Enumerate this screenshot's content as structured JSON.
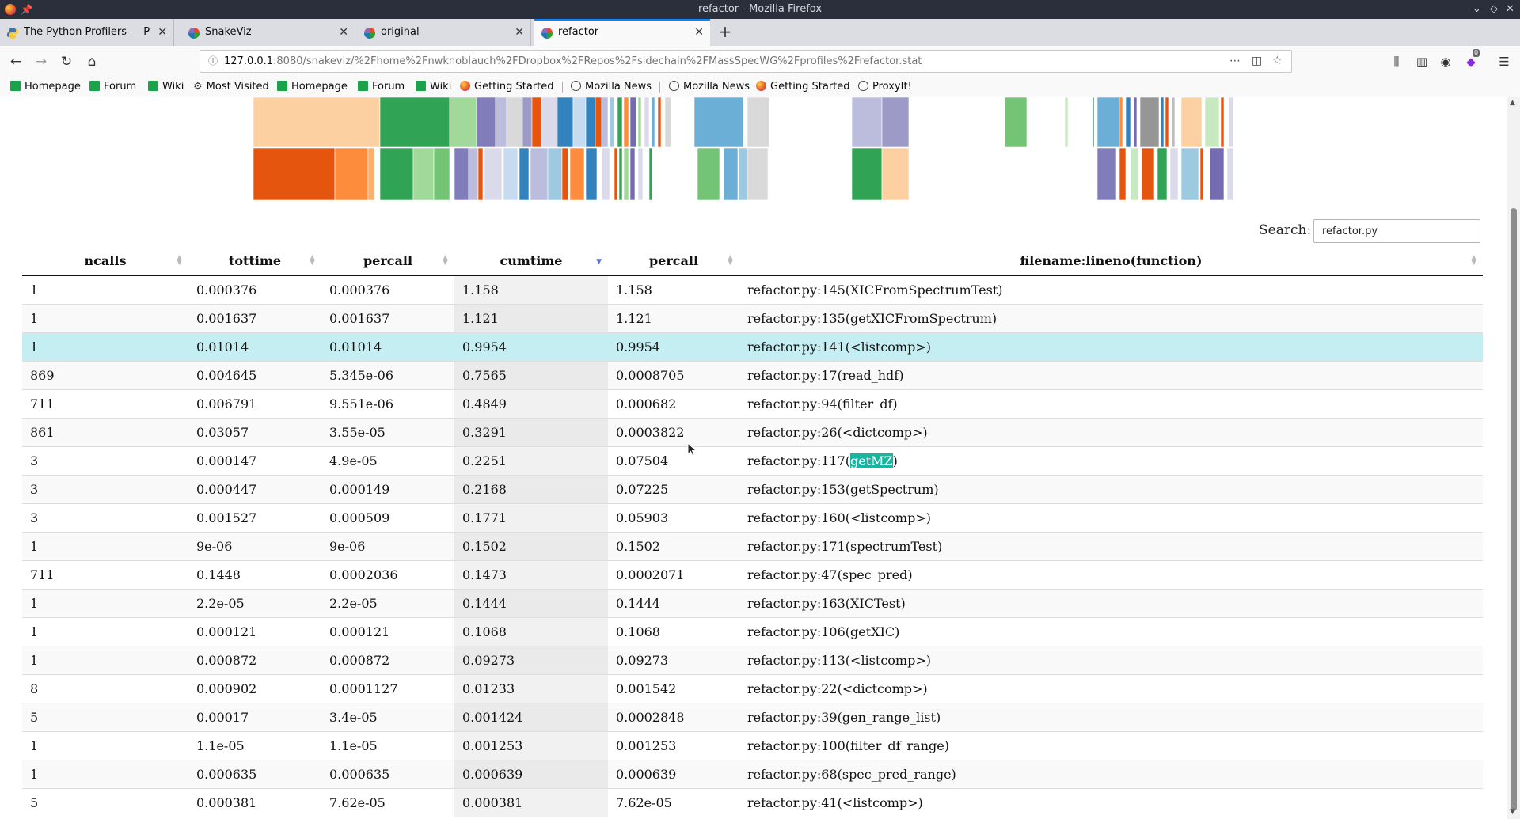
{
  "window": {
    "title": "refactor - Mozilla Firefox"
  },
  "tabs": [
    {
      "label": "The Python Profilers — Pyt",
      "icon": "python-icon"
    },
    {
      "label": "SnakeViz",
      "icon": "snakeviz-icon"
    },
    {
      "label": "original",
      "icon": "snakeviz-icon"
    },
    {
      "label": "refactor",
      "icon": "snakeviz-icon",
      "active": true
    }
  ],
  "urlbar": {
    "host": "127.0.0.1",
    "path": ":8080/snakeviz/%2Fhome%2Fnwknoblauch%2FDropbox%2FRepos%2Fsidechain%2FMassSpecWG%2Fprofiles%2Frefactor.stat"
  },
  "toolbar": {
    "badge": "0"
  },
  "bookmarks": [
    {
      "label": "Homepage",
      "icon": "green"
    },
    {
      "label": "Forum",
      "icon": "green"
    },
    {
      "label": "Wiki",
      "icon": "green"
    },
    {
      "label": "Most Visited",
      "icon": "gear"
    },
    {
      "label": "Homepage",
      "icon": "green"
    },
    {
      "label": "Forum",
      "icon": "green"
    },
    {
      "label": "Wiki",
      "icon": "green"
    },
    {
      "label": "Getting Started",
      "icon": "firefox"
    },
    {
      "label": "Mozilla News",
      "icon": "globe"
    },
    {
      "label": "Mozilla News",
      "icon": "globe"
    },
    {
      "label": "Getting Started",
      "icon": "firefox"
    },
    {
      "label": "ProxyIt!",
      "icon": "globe"
    }
  ],
  "search": {
    "label": "Search:",
    "value": "refactor.py"
  },
  "table": {
    "headers": [
      "ncalls",
      "tottime",
      "percall",
      "cumtime",
      "percall",
      "filename:lineno(function)"
    ],
    "sorted_column": "cumtime",
    "rows": [
      [
        "1",
        "0.000376",
        "0.000376",
        "1.158",
        "1.158",
        "refactor.py:145(XICFromSpectrumTest)"
      ],
      [
        "1",
        "0.001637",
        "0.001637",
        "1.121",
        "1.121",
        "refactor.py:135(getXICFromSpectrum)"
      ],
      [
        "1",
        "0.01014",
        "0.01014",
        "0.9954",
        "0.9954",
        "refactor.py:141(<listcomp>)"
      ],
      [
        "869",
        "0.004645",
        "5.345e-06",
        "0.7565",
        "0.0008705",
        "refactor.py:17(read_hdf)"
      ],
      [
        "711",
        "0.006791",
        "9.551e-06",
        "0.4849",
        "0.000682",
        "refactor.py:94(filter_df)"
      ],
      [
        "861",
        "0.03057",
        "3.55e-05",
        "0.3291",
        "0.0003822",
        "refactor.py:26(<dictcomp>)"
      ],
      [
        "3",
        "0.000147",
        "4.9e-05",
        "0.2251",
        "0.07504",
        "refactor.py:117(getMZ)"
      ],
      [
        "3",
        "0.000447",
        "0.000149",
        "0.2168",
        "0.07225",
        "refactor.py:153(getSpectrum)"
      ],
      [
        "3",
        "0.001527",
        "0.000509",
        "0.1771",
        "0.05903",
        "refactor.py:160(<listcomp>)"
      ],
      [
        "1",
        "9e-06",
        "9e-06",
        "0.1502",
        "0.1502",
        "refactor.py:171(spectrumTest)"
      ],
      [
        "711",
        "0.1448",
        "0.0002036",
        "0.1473",
        "0.0002071",
        "refactor.py:47(spec_pred)"
      ],
      [
        "1",
        "2.2e-05",
        "2.2e-05",
        "0.1444",
        "0.1444",
        "refactor.py:163(XICTest)"
      ],
      [
        "1",
        "0.000121",
        "0.000121",
        "0.1068",
        "0.1068",
        "refactor.py:106(getXIC)"
      ],
      [
        "1",
        "0.000872",
        "0.000872",
        "0.09273",
        "0.09273",
        "refactor.py:113(<listcomp>)"
      ],
      [
        "8",
        "0.000902",
        "0.0001127",
        "0.01233",
        "0.001542",
        "refactor.py:22(<dictcomp>)"
      ],
      [
        "5",
        "0.00017",
        "3.4e-05",
        "0.001424",
        "0.0002848",
        "refactor.py:39(gen_range_list)"
      ],
      [
        "1",
        "1.1e-05",
        "1.1e-05",
        "0.001253",
        "0.001253",
        "refactor.py:100(filter_df_range)"
      ],
      [
        "1",
        "0.000635",
        "0.000635",
        "0.000639",
        "0.000639",
        "refactor.py:68(spec_pred_range)"
      ],
      [
        "5",
        "0.000381",
        "7.62e-05",
        "0.000381",
        "7.62e-05",
        "refactor.py:41(<listcomp>)"
      ]
    ],
    "highlighted_row": 2,
    "highlighted_text": {
      "row": 6,
      "text": "getMZ"
    }
  },
  "colors": {
    "accent": "#0a84ff",
    "highlight_row": "#c5eef2",
    "text_highlight": "#1ab5a0",
    "sort_arrow": "#5a70d8"
  }
}
